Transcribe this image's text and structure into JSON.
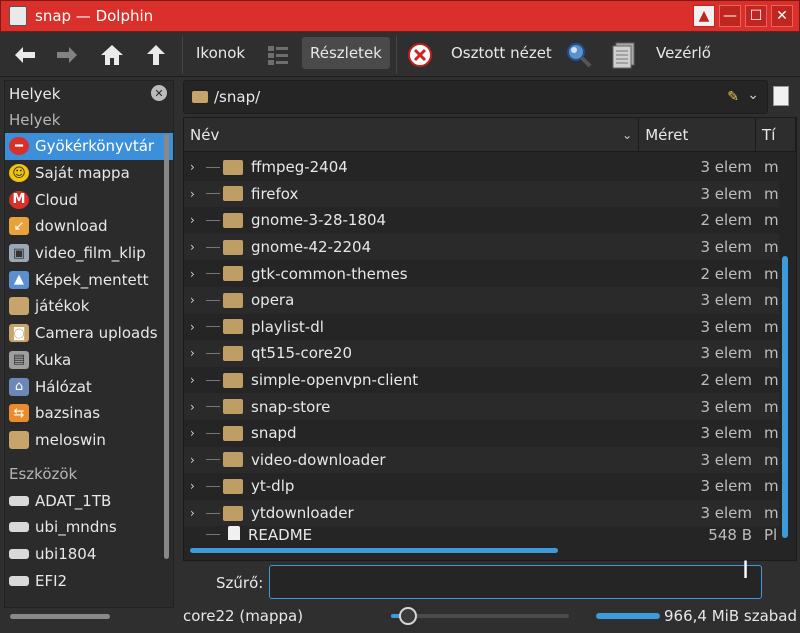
{
  "window": {
    "title": "snap — Dolphin",
    "controls": [
      "▲",
      "—",
      "☐",
      "✕"
    ]
  },
  "toolbar": {
    "back_icon": "back-arrow-icon",
    "forward_icon": "forward-arrow-icon",
    "home_icon": "home-icon",
    "up_icon": "up-arrow-icon",
    "icons_label": "Ikonok",
    "compact_icon": "compact-view-icon",
    "details_label": "Részletek",
    "split_label": "Osztott nézet",
    "search_icon": "magnifier-icon",
    "terminal_icon": "terminal-icon",
    "control_label": "Vezérlő"
  },
  "places": {
    "header": "Helyek",
    "section1": "Helyek",
    "items": [
      {
        "label": "Gyökérkönyvtár",
        "icon": "root-icon"
      },
      {
        "label": "Saját mappa",
        "icon": "home-smile-icon"
      },
      {
        "label": "Cloud",
        "icon": "mega-cloud-icon"
      },
      {
        "label": "download",
        "icon": "download-folder-icon"
      },
      {
        "label": "video_film_klip",
        "icon": "video-folder-icon"
      },
      {
        "label": "Képek_mentett",
        "icon": "pictures-icon"
      },
      {
        "label": "játékok",
        "icon": "folder-icon"
      },
      {
        "label": "Camera uploads",
        "icon": "camera-folder-icon"
      },
      {
        "label": "Kuka",
        "icon": "trash-icon"
      },
      {
        "label": "Hálózat",
        "icon": "network-icon"
      },
      {
        "label": "bazsinas",
        "icon": "share-folder-icon"
      },
      {
        "label": "meloswin",
        "icon": "folder-icon"
      }
    ],
    "section2": "Eszközök",
    "devices": [
      {
        "label": "ADAT_1TB"
      },
      {
        "label": "ubi_mndns"
      },
      {
        "label": "ubi1804"
      },
      {
        "label": "EFI2"
      }
    ]
  },
  "location": {
    "path": "/snap/"
  },
  "columns": {
    "name": "Név",
    "size": "Méret",
    "type": "Tí"
  },
  "files": [
    {
      "name": "ffmpeg-2404",
      "size": "3 elem",
      "type": "m"
    },
    {
      "name": "firefox",
      "size": "3 elem",
      "type": "m"
    },
    {
      "name": "gnome-3-28-1804",
      "size": "2 elem",
      "type": "m"
    },
    {
      "name": "gnome-42-2204",
      "size": "3 elem",
      "type": "m"
    },
    {
      "name": "gtk-common-themes",
      "size": "2 elem",
      "type": "m"
    },
    {
      "name": "opera",
      "size": "3 elem",
      "type": "m"
    },
    {
      "name": "playlist-dl",
      "size": "3 elem",
      "type": "m"
    },
    {
      "name": "qt515-core20",
      "size": "3 elem",
      "type": "m"
    },
    {
      "name": "simple-openvpn-client",
      "size": "2 elem",
      "type": "m"
    },
    {
      "name": "snap-store",
      "size": "3 elem",
      "type": "m"
    },
    {
      "name": "snapd",
      "size": "3 elem",
      "type": "m"
    },
    {
      "name": "video-downloader",
      "size": "3 elem",
      "type": "m"
    },
    {
      "name": "yt-dlp",
      "size": "3 elem",
      "type": "m"
    },
    {
      "name": "ytdownloader",
      "size": "3 elem",
      "type": "m"
    },
    {
      "name": "README",
      "size": "548 B",
      "type": "Pl"
    }
  ],
  "filter": {
    "label": "Szűrő:",
    "value": ""
  },
  "status": {
    "text": "core22 (mappa)",
    "free_space": "966,4 MiB szabad"
  }
}
